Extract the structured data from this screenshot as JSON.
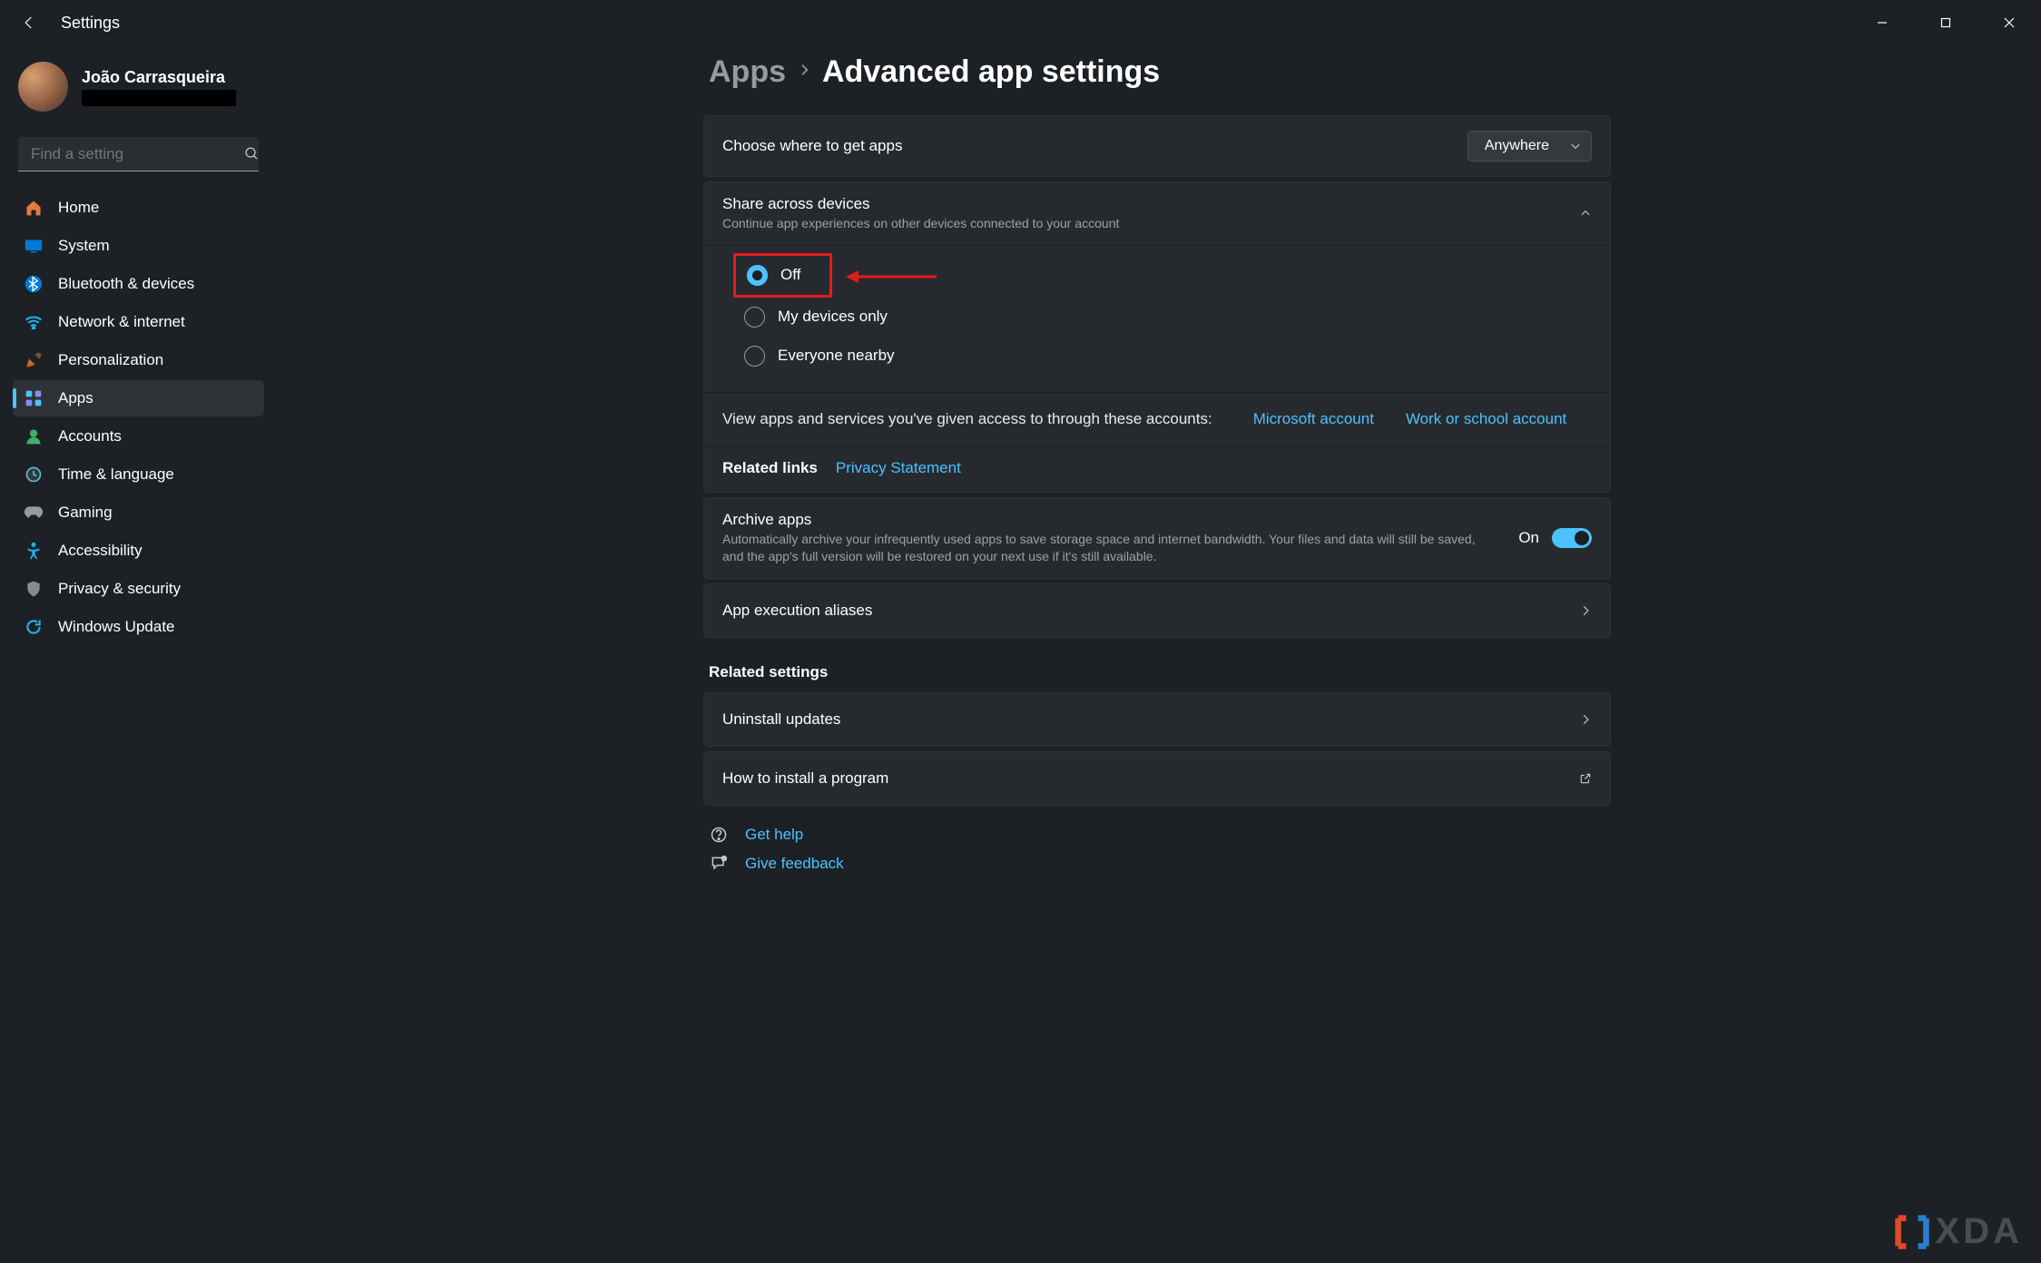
{
  "titlebar": {
    "title": "Settings"
  },
  "user": {
    "name": "João Carrasqueira"
  },
  "search": {
    "placeholder": "Find a setting"
  },
  "nav": {
    "home": "Home",
    "system": "System",
    "bluetooth": "Bluetooth & devices",
    "network": "Network & internet",
    "personalization": "Personalization",
    "apps": "Apps",
    "accounts": "Accounts",
    "time": "Time & language",
    "gaming": "Gaming",
    "accessibility": "Accessibility",
    "privacy": "Privacy & security",
    "update": "Windows Update"
  },
  "breadcrumb": {
    "parent": "Apps",
    "current": "Advanced app settings"
  },
  "cards": {
    "getapps": {
      "label": "Choose where to get apps",
      "value": "Anywhere"
    },
    "share": {
      "label": "Share across devices",
      "sub": "Continue app experiences on other devices connected to your account",
      "opt_off": "Off",
      "opt_mine": "My devices only",
      "opt_every": "Everyone nearby"
    },
    "access": {
      "text": "View apps and services you've given access to through these accounts:",
      "ms": "Microsoft account",
      "work": "Work or school account"
    },
    "related": {
      "label": "Related links",
      "privacy": "Privacy Statement"
    },
    "archive": {
      "label": "Archive apps",
      "sub": "Automatically archive your infrequently used apps to save storage space and internet bandwidth. Your files and data will still be saved, and the app's full version will be restored on your next use if it's still available.",
      "state": "On"
    },
    "aliases": {
      "label": "App execution aliases"
    }
  },
  "related_h": "Related settings",
  "related": {
    "uninstall": "Uninstall updates",
    "howto": "How to install a program"
  },
  "footer": {
    "help": "Get help",
    "feedback": "Give feedback"
  },
  "watermark": "XDA"
}
